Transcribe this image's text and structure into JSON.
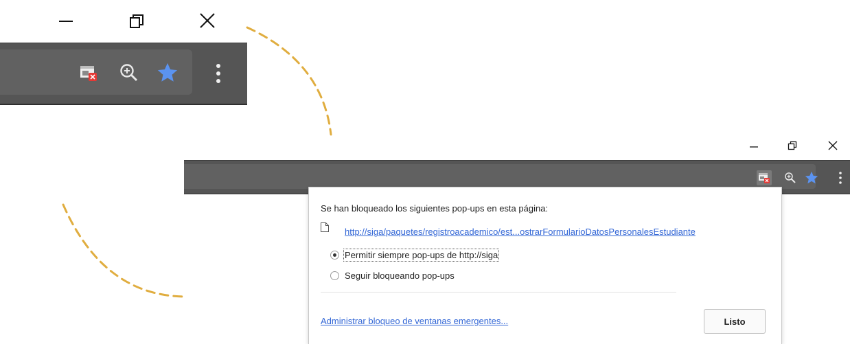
{
  "zoom_inset": {
    "window_controls": [
      "minimize-icon",
      "restore-icon",
      "close-icon"
    ],
    "toolbar_icons": [
      "popup-blocked-icon",
      "zoom-icon",
      "bookmark-star-icon",
      "menu-icon"
    ]
  },
  "toolbar": {
    "icons": [
      "popup-blocked-icon",
      "zoom-icon",
      "bookmark-star-icon",
      "menu-icon"
    ]
  },
  "popup": {
    "title": "Se han bloqueado los siguientes pop-ups en esta página:",
    "blocked_link": "http://siga/paquetes/registroacademico/est...ostrarFormularioDatosPersonalesEstudiante",
    "options": [
      {
        "label": "Permitir siempre pop-ups de http://siga",
        "selected": true
      },
      {
        "label": "Seguir bloqueando pop-ups",
        "selected": false
      }
    ],
    "manage_link": "Administrar bloqueo de ventanas emergentes...",
    "done_button": "Listo"
  },
  "colors": {
    "toolbar_bg": "#555555",
    "omnibox_bg": "#616161",
    "accent_dash": "#e0ad3f",
    "star_blue": "#5b93f0",
    "link_blue": "#3367d6",
    "blocked_red": "#e53935"
  }
}
